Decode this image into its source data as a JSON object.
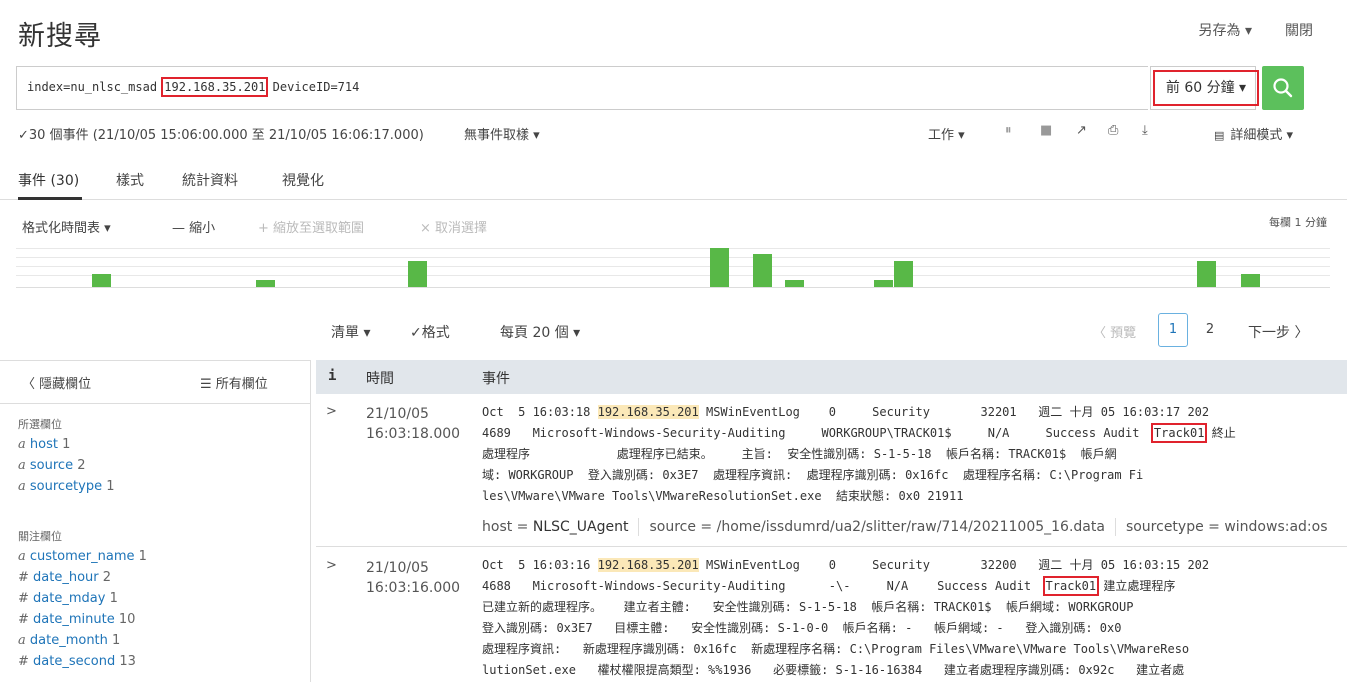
{
  "header": {
    "title": "新搜尋",
    "save_as": "另存為 ▾",
    "close": "關閉"
  },
  "search": {
    "query_prefix": "index=nu_nlsc_msad ",
    "query_ip": "192.168.35.201",
    "query_suffix": " DeviceID=714",
    "time_range": "前 60 分鐘 ▾"
  },
  "status": {
    "summary": "✓30 個事件 (21/10/05 15:06:00.000 至 21/10/05 16:06:17.000)",
    "sampling": "無事件取樣 ▾",
    "jobs": "工作 ▾",
    "mode": "詳細模式 ▾"
  },
  "tabs": [
    "事件 (30)",
    "樣式",
    "統計資料",
    "視覺化"
  ],
  "timeline": {
    "format": "格式化時間表 ▾",
    "zoom_out": "— 縮小",
    "zoom_selection": "+ 縮放至選取範圍",
    "deselect": "× 取消選擇",
    "scale": "每欄 1 分鐘",
    "bars": [
      {
        "col": 0.058,
        "v": 1
      },
      {
        "col": 0.183,
        "v": 0.5
      },
      {
        "col": 0.298,
        "v": 2
      },
      {
        "col": 0.528,
        "v": 3
      },
      {
        "col": 0.561,
        "v": 2.5
      },
      {
        "col": 0.585,
        "v": 0.5
      },
      {
        "col": 0.653,
        "v": 0.5
      },
      {
        "col": 0.668,
        "v": 2
      },
      {
        "col": 0.899,
        "v": 2
      },
      {
        "col": 0.932,
        "v": 1
      }
    ]
  },
  "list_controls": {
    "list": "清單 ▾",
    "format": "✓格式",
    "per_page": "每頁 20 個 ▾",
    "prev": "〈 預覽",
    "page1": "1",
    "page2": "2",
    "next": "下一步 〉"
  },
  "sidebar": {
    "hide": "〈 隱藏欄位",
    "all": "☰ 所有欄位",
    "selected_title": "所選欄位",
    "selected": [
      {
        "t": "a",
        "name": "host",
        "count": "1"
      },
      {
        "t": "a",
        "name": "source",
        "count": "2"
      },
      {
        "t": "a",
        "name": "sourcetype",
        "count": "1"
      }
    ],
    "interesting_title": "關注欄位",
    "interesting": [
      {
        "t": "a",
        "name": "customer_name",
        "count": "1"
      },
      {
        "t": "#",
        "name": "date_hour",
        "count": "2"
      },
      {
        "t": "#",
        "name": "date_mday",
        "count": "1"
      },
      {
        "t": "#",
        "name": "date_minute",
        "count": "10"
      },
      {
        "t": "a",
        "name": "date_month",
        "count": "1"
      },
      {
        "t": "#",
        "name": "date_second",
        "count": "13"
      }
    ]
  },
  "table": {
    "col_i": "i",
    "col_time": "時間",
    "col_event": "事件",
    "rows": [
      {
        "date": "21/10/05",
        "time": "16:03:18.000",
        "l1a": "Oct  5 16:03:18 ",
        "l1ip": "192.168.35.201",
        "l1b": " MSWinEventLog    0     Security       32201   週二 十月 05 16:03:17 202",
        "l2a": "4689   Microsoft-Windows-Security-Auditing     WORKGROUP\\TRACK01$     N/A     Success Audit  ",
        "l2track": "Track01",
        "l2b": " 終止",
        "l3": "處理程序            處理程序已結束。    主旨:  安全性識別碼: S-1-5-18  帳戶名稱: TRACK01$  帳戶網",
        "l4": "域: WORKGROUP  登入識別碼: 0x3E7  處理程序資訊:  處理程序識別碼: 0x16fc  處理程序名稱: C:\\Program Fi",
        "l5": "les\\VMware\\VMware Tools\\VMwareResolutionSet.exe  結束狀態: 0x0 21911",
        "host_label": "host = ",
        "host": "NLSC_UAgent",
        "source": "source = /home/issdumrd/ua2/slitter/raw/714/20211005_16.data",
        "sourcetype": "sourcetype = windows:ad:os"
      },
      {
        "date": "21/10/05",
        "time": "16:03:16.000",
        "l1a": "Oct  5 16:03:16 ",
        "l1ip": "192.168.35.201",
        "l1b": " MSWinEventLog    0     Security       32200   週二 十月 05 16:03:15 202",
        "l2a": "4688   Microsoft-Windows-Security-Auditing      -\\-     N/A    Success Audit  ",
        "l2track": "Track01",
        "l2b": " 建立處理程序",
        "l3": "已建立新的處理程序。   建立者主體:   安全性識別碼: S-1-5-18  帳戶名稱: TRACK01$  帳戶網域: WORKGROUP",
        "l4": "登入識別碼: 0x3E7   目標主體:   安全性識別碼: S-1-0-0  帳戶名稱: -   帳戶網域: -   登入識別碼: 0x0",
        "l5": "處理程序資訊:   新處理程序識別碼: 0x16fc  新處理程序名稱: C:\\Program Files\\VMware\\VMware Tools\\VMwareReso",
        "l6": "lutionSet.exe   權杖權限提高類型: %%1936   必要標籤: S-1-16-16384   建立者處理程序識別碼: 0x92c   建立者處"
      }
    ]
  },
  "colors": {
    "accent": "#5cc05c",
    "link": "#1e74b8",
    "highlight": "#fbe8b8",
    "redbox": "#e0232d"
  }
}
